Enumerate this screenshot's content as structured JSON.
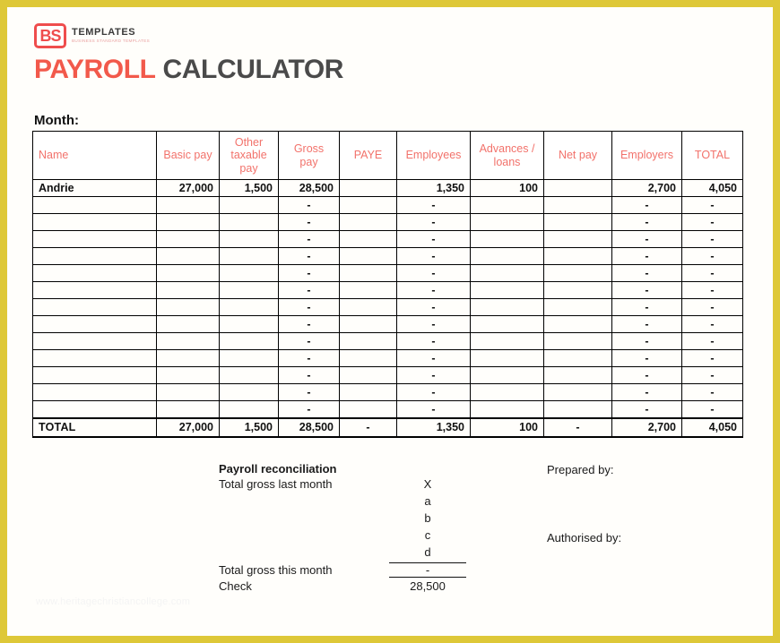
{
  "brand": {
    "logo_mark": "BS",
    "logo_title": "TEMPLATES",
    "logo_subtitle": "BUSINESS STANDARD TEMPLATES",
    "accent_red": "#ef4d4d",
    "border_gold": "#dec838",
    "header_text_color": "#f2726b"
  },
  "title": {
    "word_primary": "PAYROLL",
    "word_secondary": "CALCULATOR"
  },
  "month": {
    "label": "Month:",
    "value": ""
  },
  "table": {
    "headers": [
      "Name",
      "Basic pay",
      "Other taxable pay",
      "Gross pay",
      "PAYE",
      "Employees",
      "Advances / loans",
      "Net pay",
      "Employers",
      "TOTAL"
    ],
    "rows": [
      {
        "name": "Andrie",
        "basic_pay": "27,000",
        "other_taxable_pay": "1,500",
        "gross_pay": "28,500",
        "paye": "",
        "employees": "1,350",
        "advances_loans": "100",
        "net_pay": "",
        "employers": "2,700",
        "total": "4,050"
      },
      {
        "name": "",
        "basic_pay": "",
        "other_taxable_pay": "",
        "gross_pay": "-",
        "paye": "",
        "employees": "-",
        "advances_loans": "",
        "net_pay": "",
        "employers": "-",
        "total": "-"
      },
      {
        "name": "",
        "basic_pay": "",
        "other_taxable_pay": "",
        "gross_pay": "-",
        "paye": "",
        "employees": "-",
        "advances_loans": "",
        "net_pay": "",
        "employers": "-",
        "total": "-"
      },
      {
        "name": "",
        "basic_pay": "",
        "other_taxable_pay": "",
        "gross_pay": "-",
        "paye": "",
        "employees": "-",
        "advances_loans": "",
        "net_pay": "",
        "employers": "-",
        "total": "-"
      },
      {
        "name": "",
        "basic_pay": "",
        "other_taxable_pay": "",
        "gross_pay": "-",
        "paye": "",
        "employees": "-",
        "advances_loans": "",
        "net_pay": "",
        "employers": "-",
        "total": "-"
      },
      {
        "name": "",
        "basic_pay": "",
        "other_taxable_pay": "",
        "gross_pay": "-",
        "paye": "",
        "employees": "-",
        "advances_loans": "",
        "net_pay": "",
        "employers": "-",
        "total": "-"
      },
      {
        "name": "",
        "basic_pay": "",
        "other_taxable_pay": "",
        "gross_pay": "-",
        "paye": "",
        "employees": "-",
        "advances_loans": "",
        "net_pay": "",
        "employers": "-",
        "total": "-"
      },
      {
        "name": "",
        "basic_pay": "",
        "other_taxable_pay": "",
        "gross_pay": "-",
        "paye": "",
        "employees": "-",
        "advances_loans": "",
        "net_pay": "",
        "employers": "-",
        "total": "-"
      },
      {
        "name": "",
        "basic_pay": "",
        "other_taxable_pay": "",
        "gross_pay": "-",
        "paye": "",
        "employees": "-",
        "advances_loans": "",
        "net_pay": "",
        "employers": "-",
        "total": "-"
      },
      {
        "name": "",
        "basic_pay": "",
        "other_taxable_pay": "",
        "gross_pay": "-",
        "paye": "",
        "employees": "-",
        "advances_loans": "",
        "net_pay": "",
        "employers": "-",
        "total": "-"
      },
      {
        "name": "",
        "basic_pay": "",
        "other_taxable_pay": "",
        "gross_pay": "-",
        "paye": "",
        "employees": "-",
        "advances_loans": "",
        "net_pay": "",
        "employers": "-",
        "total": "-"
      },
      {
        "name": "",
        "basic_pay": "",
        "other_taxable_pay": "",
        "gross_pay": "-",
        "paye": "",
        "employees": "-",
        "advances_loans": "",
        "net_pay": "",
        "employers": "-",
        "total": "-"
      },
      {
        "name": "",
        "basic_pay": "",
        "other_taxable_pay": "",
        "gross_pay": "-",
        "paye": "",
        "employees": "-",
        "advances_loans": "",
        "net_pay": "",
        "employers": "-",
        "total": "-"
      },
      {
        "name": "",
        "basic_pay": "",
        "other_taxable_pay": "",
        "gross_pay": "-",
        "paye": "",
        "employees": "-",
        "advances_loans": "",
        "net_pay": "",
        "employers": "-",
        "total": "-"
      }
    ],
    "total_row": {
      "name": "TOTAL",
      "basic_pay": "27,000",
      "other_taxable_pay": "1,500",
      "gross_pay": "28,500",
      "paye": "-",
      "employees": "1,350",
      "advances_loans": "100",
      "net_pay": "-",
      "employers": "2,700",
      "total": "4,050"
    }
  },
  "reconciliation": {
    "title": "Payroll reconciliation",
    "rows": [
      {
        "label": "Total gross last month",
        "value": "X"
      },
      {
        "label": "",
        "value": "a"
      },
      {
        "label": "",
        "value": "b"
      },
      {
        "label": "",
        "value": "c"
      },
      {
        "label": "",
        "value": "d"
      },
      {
        "label": "Total gross this month",
        "value": "-"
      },
      {
        "label": "Check",
        "value": "28,500"
      }
    ]
  },
  "signatures": {
    "prepared_by": "Prepared by:",
    "authorised_by": "Authorised by:"
  },
  "watermark": {
    "text": "www.heritagechristiancollege.com"
  }
}
